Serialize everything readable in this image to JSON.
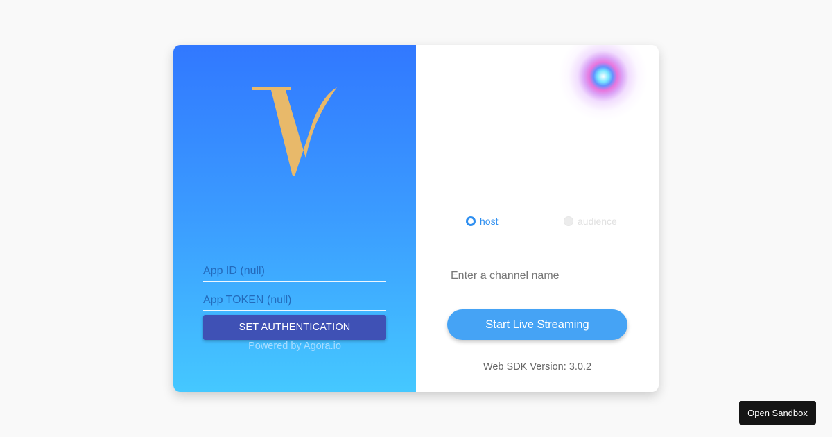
{
  "left_panel": {
    "logo_icon": "v-letter-logo",
    "app_id": {
      "value": "",
      "placeholder": "App ID (null)"
    },
    "app_token": {
      "value": "",
      "placeholder": "App TOKEN (null)"
    },
    "auth_button_label": "SET AUTHENTICATION",
    "powered_by": "Powered by Agora.io"
  },
  "right_panel": {
    "role_options": [
      {
        "label": "host",
        "selected": true
      },
      {
        "label": "audience",
        "selected": false
      }
    ],
    "channel": {
      "value": "",
      "placeholder": "Enter a channel name"
    },
    "start_button_label": "Start Live Streaming",
    "sdk_version": "Web SDK Version: 3.0.2"
  },
  "sandbox_button_label": "Open Sandbox",
  "colors": {
    "gradient_top": "#3178ff",
    "gradient_bottom": "#45c8ff",
    "logo_gold": "#e8b96a",
    "auth_button": "#3f51b5",
    "stream_button": "#45a3f5",
    "radio_active": "#2f8ff0"
  }
}
